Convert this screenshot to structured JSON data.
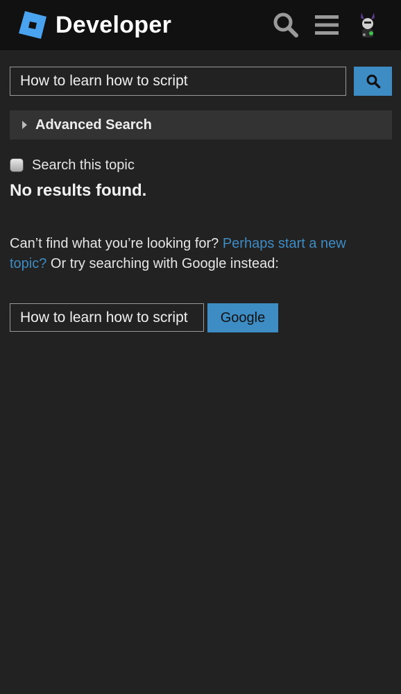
{
  "header": {
    "title": "Developer",
    "logo_icon": "roblox-logo-icon",
    "search_icon": "search-icon",
    "menu_icon": "hamburger-menu-icon",
    "avatar_icon": "user-avatar"
  },
  "search": {
    "value": "How to learn how to script",
    "submit_icon": "search-icon"
  },
  "advanced_search": {
    "label": "Advanced Search"
  },
  "topic_filter": {
    "label": "Search this topic",
    "checked": false
  },
  "results": {
    "message": "No results found."
  },
  "help": {
    "prefix": "Can’t find what you’re looking for? ",
    "link_text": "Perhaps start a new topic?",
    "suffix": " Or try searching with Google instead:"
  },
  "google_search": {
    "value": "How to learn how to script",
    "button_label": "Google"
  },
  "colors": {
    "background": "#222222",
    "header": "#111111",
    "accent": "#3e8cc4",
    "panel": "#333333",
    "text": "#e6e6e6"
  }
}
